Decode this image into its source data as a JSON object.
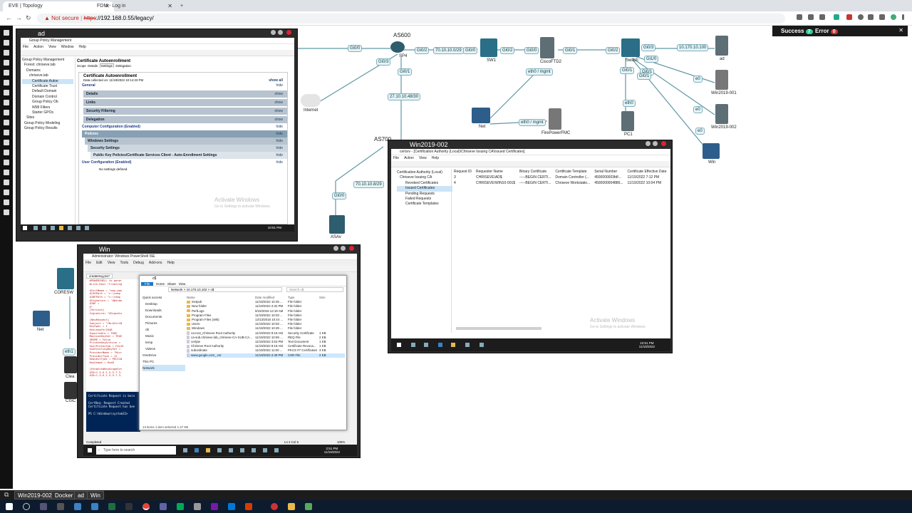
{
  "browser": {
    "tabs": [
      {
        "label": "EVE | Topology",
        "active": true
      },
      {
        "label": "FDM - Log in",
        "active": false
      }
    ],
    "address": {
      "warning": "Not secure",
      "protocol": "https",
      "rest": "://192.168.0.55/legacy/"
    }
  },
  "status_bar": {
    "success_label": "Success",
    "success_count": "7",
    "error_label": "Error",
    "error_count": "0"
  },
  "topology": {
    "nodes": {
      "sp4": "SP4",
      "as600": "AS600",
      "sw1": "SW1",
      "ciscoftd2": "CiscoFTD2",
      "switch": "Switch",
      "ad": "ad",
      "win2019_001": "Win2019-001",
      "win2019_002": "Win2019-002",
      "win": "Win",
      "internet": "Internet",
      "net_top": "Net",
      "firepowerfmc": "FirePowerFMC",
      "pc1": "PC1",
      "as700": "AS700",
      "asav": "ASAv",
      "coresw": "CORESW",
      "net_left": "Net",
      "clear": "Clea",
      "cisc": "CISC"
    },
    "links": {
      "gi0_0_a": "Gi0/0",
      "gi0_3_a": "Gi0/3",
      "gi0_2_a": "Gi0/2",
      "net_a": "70.10.10.0/29",
      "gi0_0_b": "Gi0/0",
      "gi0_2_b": "Gi0/2",
      "gi0_0_c": "Gi0/0",
      "gi0_1_a": "Gi0/1",
      "gi0_2_c": "Gi0/2",
      "gi0_3_b": "Gi0/3",
      "net_b": "10.170.10.100",
      "gi1_0": "Gi1/0",
      "gi0_1_b": "Gi0/1",
      "gi0_1_c": "Gi0/1",
      "gi0_1_d": "Gi0/1",
      "net_c": "27.10.10.48/30",
      "gi0_1_e": "Gi0/1",
      "eth0_mgmt_a": "eth0 / mgmt",
      "eth0_mgmt_b": "eth0 / mgmt",
      "eth0_a": "eth0",
      "e0_a": "e0",
      "e0_b": "e0",
      "e0_c": "e0",
      "net_d": "70.10.10.8/29",
      "gi0_0_d": "Gi0/0",
      "eth1": "eth1"
    }
  },
  "win_ad": {
    "title": "ad",
    "gpm_title": "Group Policy Management",
    "menu": [
      "File",
      "Action",
      "View",
      "Window",
      "Help"
    ],
    "tree": [
      "Group Policy Management",
      "Forest: chriseve.lab",
      "Domains",
      "chriseve.lab",
      "Certificate Autoe",
      "Certificate Trust",
      "Default Domain",
      "Domain Control",
      "Group Policy Ob",
      "WMI Filters",
      "Starter GPOs",
      "Sites",
      "Group Policy Modeling",
      "Group Policy Results"
    ],
    "pane_title": "Certificate Autoenrollment",
    "pane_tabs": [
      "Scope",
      "Details",
      "Settings",
      "Delegation"
    ],
    "report_title": "Certificate Autoenrollment",
    "data_collected": "Data collected on: 11/19/2022 10:14:23 PM",
    "show_all": "show all",
    "general": "General",
    "details": "Details",
    "links": "Links",
    "security_filtering": "Security Filtering",
    "delegation": "Delegation",
    "computer_config": "Computer Configuration (Enabled)",
    "policies": "Policies",
    "windows_settings": "Windows Settings",
    "security_settings": "Security Settings",
    "public_key": "Public Key Policies/Certificate Services Client - Auto-Enrollment Settings",
    "user_config": "User Configuration (Enabled)",
    "no_settings": "No settings defined.",
    "hide": "hide",
    "show": "show",
    "activate": "Activate Windows",
    "activate_sub": "Go to Settings to activate Windows.",
    "clock_time": "10:51 PM",
    "clock_date": "11/19/2022"
  },
  "win_ca": {
    "title": "Win2019-002",
    "mmc_title": "certsrv - [Certification Authority (Local)\\Chriseve Issuing CA\\Issued Certificates]",
    "menu": [
      "File",
      "Action",
      "View",
      "Help"
    ],
    "tree": [
      "Certification Authority (Local)",
      "Chriseve Issuing CA",
      "Revoked Certificates",
      "Issued Certificates",
      "Pending Requests",
      "Failed Requests",
      "Certificate Templates"
    ],
    "columns": [
      "Request ID",
      "Requester Name",
      "Binary Certificate",
      "Certificate Template",
      "Serial Number",
      "Certificate Effective Date"
    ],
    "rows": [
      [
        "3",
        "CHRISEVE\\AD$",
        "-----BEGIN CERTI...",
        "Domain Controller (...",
        "4500000003fdf...",
        "11/19/2022 7:12 PM"
      ],
      [
        "4",
        "CHRISEVE\\WIN10-001$",
        "-----BEGIN CERTI...",
        "Chriseve Workstatio...",
        "4500000004886...",
        "11/19/2022 10:04 PM"
      ]
    ],
    "activate": "Activate Windows",
    "activate_sub": "Go to Settings to activate Windows.",
    "clock_time": "10:51 PM",
    "clock_date": "11/19/2022"
  },
  "win_win": {
    "title": "Win",
    "ps_title": "Administrator: Windows PowerShell ISE",
    "menu": [
      "File",
      "Edit",
      "View",
      "Tools",
      "Debug",
      "Add-ons",
      "Help"
    ],
    "script_tab": "createreq.ps1*",
    "code": "  #POWERSHELL to gener\n  Write-Host \"Creating\n\n  $CertName = \"www.goo\n  $CSRPath = \"c:\\temp\n  $INFPath = \"c:\\temp\n  $Signature = '$Windo\n  $INF =\n  @\"\n  [Version]\n  Signature= \"$Signatu\n\n  [NewRequest]\n  Subject = \"CN=$CertN\n  KeySpec = 1\n  KeyLength=2048\n  Exportable = TRUE\n  MachineKeySet = TRUE\n  SMIME = False\n  PrivateKeyArchive =\n  UserProtected = FALSE\n  UseExistingKeySet =\n  ProviderName = \"Micr\n  ProviderType = 12\n  RequestType = PKCS10\n  KeyUsage = 0xa0\n\n  [EnhancedKeyUsageExt\n  OID=1.3.6.1.5.5.7.3.\n  OID=1.3.6.1.5.5.7.3.",
    "console": "Certificate Request is bein\n\nCertReq: Request Created\nCertificate Request has bee\n\nPS C:\\Windows\\system32>",
    "explorer": {
      "path_label": "c$",
      "ribbon": [
        "File",
        "Home",
        "Share",
        "View"
      ],
      "breadcrumb": "Network  >  10.170.10.102  >  c$",
      "search": "Search c$",
      "nav": [
        "Quick access",
        "Desktop",
        "Downloads",
        "Documents",
        "Pictures",
        "c$",
        "Music",
        "temp",
        "Videos",
        "OneDrive",
        "This PC",
        "Network"
      ],
      "columns": [
        "Name",
        "Date modified",
        "Type",
        "Size"
      ],
      "rows": [
        [
          "inetpub",
          "11/19/2022 10:45 ...",
          "File folder",
          ""
        ],
        [
          "New folder",
          "11/19/2022 2:32 PM",
          "File folder",
          ""
        ],
        [
          "PerfLogs",
          "9/15/2018 12:19 AM",
          "File folder",
          ""
        ],
        [
          "Program Files",
          "11/19/2022 10:03 ...",
          "File folder",
          ""
        ],
        [
          "Program Files (x86)",
          "12/13/2018 10:44 ...",
          "File folder",
          ""
        ],
        [
          "Users",
          "11/19/2022 10:03 ...",
          "File folder",
          ""
        ],
        [
          "Windows",
          "11/19/2022 10:49 ...",
          "File folder",
          ""
        ],
        [
          "ca-root_Chriseve Root Authority",
          "11/19/2022 8:18 AM",
          "Security Certificate",
          "1 KB"
        ],
        [
          "ca-sub.chriseve.lab_chriseve-CA-SUB-CA...",
          "11/19/2022 10:59 ...",
          "REQ File",
          "2 KB"
        ],
        [
          "certpw",
          "11/19/2022 3:53 PM",
          "Text Document",
          "1 KB"
        ],
        [
          "Chriseve Root Authority",
          "11/19/2022 8:18 AM",
          "Certificate Revoca...",
          "1 KB"
        ],
        [
          "subordinate",
          "11/19/2022 11:00 ...",
          "PKCS #7 Certificates",
          "3 KB"
        ],
        [
          "www.google.com_.csr",
          "11/19/2022 2:49 PM",
          "CSR File",
          "2 KB"
        ]
      ],
      "status": "13 items    1 item selected  1.47 KB"
    },
    "ise_status": "Completed",
    "ise_pos": "Ln 2  Col 6",
    "zoom": "100%",
    "search_placeholder": "Type here to search",
    "clock_time": "2:51 PM",
    "clock_date": "11/19/2022"
  },
  "eve_taskbar": [
    "Win2019-002",
    "Docker",
    "ad",
    "Win"
  ]
}
